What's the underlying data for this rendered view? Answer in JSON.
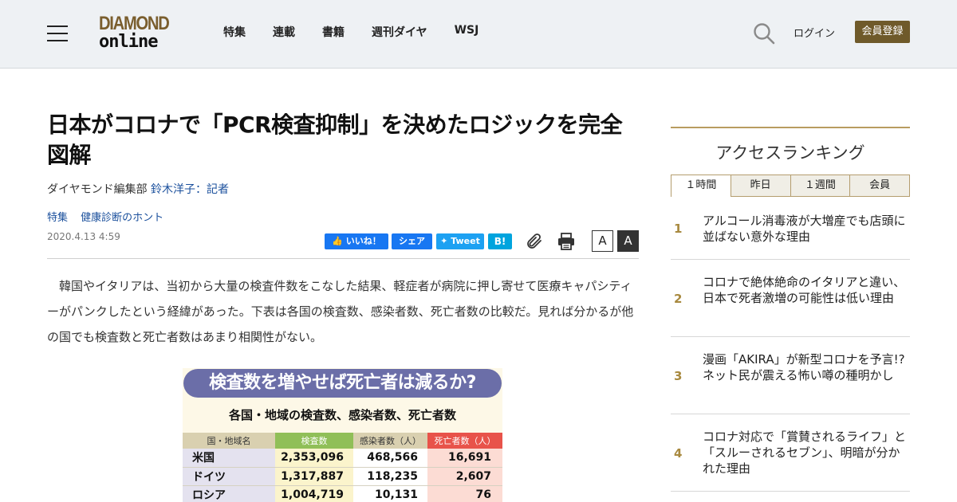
{
  "header": {
    "logo_top": "DIAMOND",
    "logo_bottom": "online",
    "nav": [
      "特集",
      "連載",
      "書籍",
      "週刊ダイヤ",
      "WSJ"
    ],
    "login": "ログイン",
    "register": "会員登録",
    "icons": {
      "menu": "hamburger-icon",
      "search": "search-icon"
    },
    "colors": {
      "background": "#eef1f4",
      "brand": "#6f5a2a"
    }
  },
  "article": {
    "title": "日本がコロナで「PCR検査抑制」を決めたロジックを完全図解",
    "author_prefix": "ダイヤモンド編集部",
    "author_link": "鈴木洋子：記者",
    "tags": [
      "特集",
      "健康診断のホント"
    ],
    "date": "2020.4.13 4:59",
    "share": {
      "like": "いいね！",
      "share": "シェア",
      "tweet": "Tweet",
      "hatena": "B!"
    },
    "font_small": "A",
    "font_large": "A",
    "body": "韓国やイタリアは、当初から大量の検査件数をこなした結果、軽症者が病院に押し寄せて医療キャパシティーがパンクしたという経緯があった。下表は各国の検査数、感染者数、死亡者数の比較だ。見れば分かるが他の国でも検査数と死亡者数はあまり相関性がない。"
  },
  "figure": {
    "title": "検査数を増やせば死亡者は減るか?",
    "subtitle": "各国・地域の検査数、感染者数、死亡者数",
    "columns": [
      "国・地域名",
      "検査数",
      "感染者数（人）",
      "死亡者数（人）"
    ],
    "rows": [
      [
        "米国",
        "2,353,096",
        "468,566",
        "16,691"
      ],
      [
        "ドイツ",
        "1,317,887",
        "118,235",
        "2,607"
      ],
      [
        "ロシア",
        "1,004,719",
        "10,131",
        "76"
      ]
    ],
    "colors": {
      "title_bg": "#6b6ea8",
      "tests_header": "#90bf58",
      "deaths_header": "#e8534a"
    }
  },
  "sidebar": {
    "title": "アクセスランキング",
    "tabs": [
      "１時間",
      "昨日",
      "１週間",
      "会員"
    ],
    "ranking": [
      {
        "rank": "1",
        "title": "アルコール消毒液が大増産でも店頭に並ばない意外な理由"
      },
      {
        "rank": "2",
        "title": "コロナで絶体絶命のイタリアと違い、日本で死者激増の可能性は低い理由"
      },
      {
        "rank": "3",
        "title": "漫画「AKIRA」が新型コロナを予言!?ネット民が震える怖い噂の種明かし"
      },
      {
        "rank": "4",
        "title": "コロナ対応で「賞賛されるライフ」と「スルーされるセブン」、明暗が分かれた理由"
      }
    ]
  }
}
